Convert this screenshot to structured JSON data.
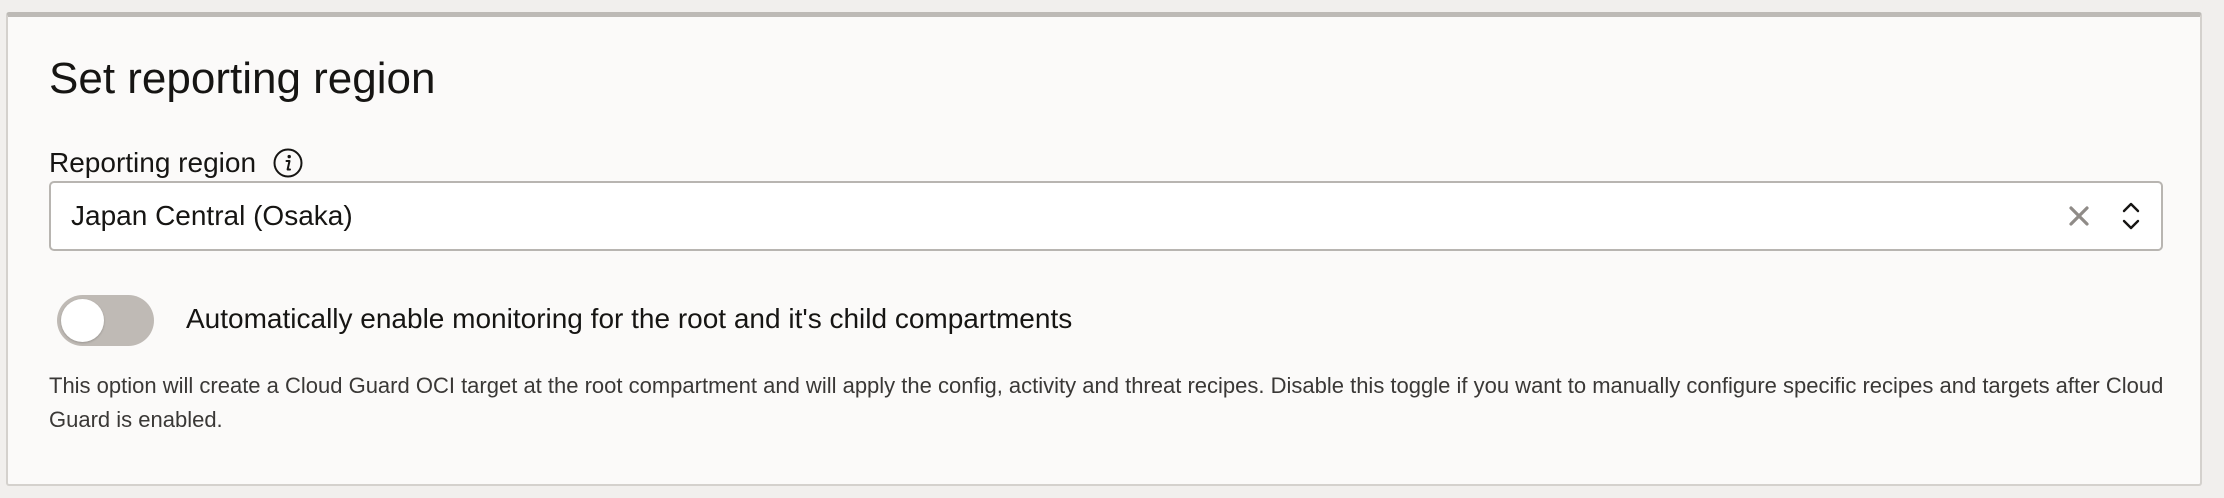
{
  "panel": {
    "title": "Set reporting region"
  },
  "reporting_region": {
    "label": "Reporting region",
    "info_icon": "info-icon",
    "selected_value": "Japan Central (Osaka)",
    "clear_icon": "close-icon",
    "toggle_icon": "chevron-up-down-icon"
  },
  "auto_monitoring": {
    "enabled": false,
    "label": "Automatically enable monitoring for the root and it's child compartments",
    "help_text": "This option will create a Cloud Guard OCI target at the root compartment and will apply the config, activity and threat recipes. Disable this toggle if you want to manually configure specific recipes and targets after Cloud Guard is enabled."
  },
  "colors": {
    "toggle_off": "#bfbab5",
    "panel_bg": "#fbfaf9",
    "border": "#b8b5b1"
  }
}
